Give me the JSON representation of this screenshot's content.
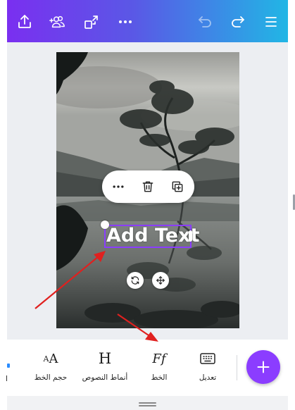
{
  "colors": {
    "accent": "#8b3dff",
    "annotation_arrow": "#e0201f",
    "toolbar_gradient_start": "#7a2ff0",
    "toolbar_gradient_end": "#21b6e5"
  },
  "topbar": {
    "icons": [
      "share-upload-icon",
      "add-people-icon",
      "magic-resize-icon",
      "more-icon",
      "undo-icon",
      "redo-icon",
      "menu-icon"
    ]
  },
  "canvas": {
    "image": "lake-tree-photo",
    "text_element": "Add Text"
  },
  "context_menu": {
    "icons": [
      "more-icon",
      "delete-icon",
      "duplicate-icon"
    ]
  },
  "bottom_tools": {
    "partial_label": "ا",
    "font_size": {
      "glyph": "AA",
      "label": "حجم الخط"
    },
    "text_styles": {
      "glyph": "H",
      "label": "أنماط النصوص"
    },
    "font": {
      "glyph": "Ff",
      "label": "الخط"
    },
    "edit": {
      "label": "تعديل"
    },
    "add_button": "plus-icon"
  }
}
